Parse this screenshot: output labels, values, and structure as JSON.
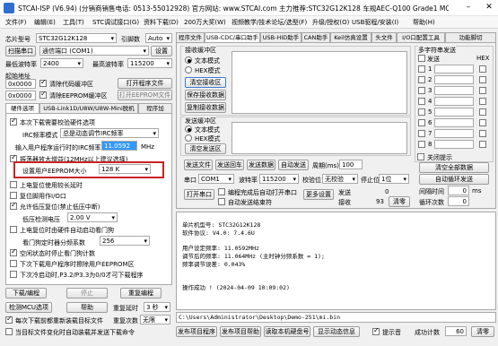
{
  "window": {
    "title": "STCAI-ISP (V6.94) (分销商销售电话: 0513-55012928) 官方网站: www.STCAI.com  主力推荐:STC32G12K128  车规AEC-Q100 Grade1 MCU设计公司 使用本芯片或采用"
  },
  "menu": [
    "文件(F)",
    "编辑(E)",
    "工具(T)",
    "STC调试接口(G)",
    "资料下载(D)",
    "200万大奖(W)",
    "视频教学/技术论坛/选型(F)",
    "升级/授权(O)",
    "USB驱程/安装(I)",
    "帮助(H)"
  ],
  "left": {
    "chip_model_label": "芯片型号",
    "chip_model": "STC32G12K128",
    "pin_count_label": "引脚数",
    "pin_count": "Auto",
    "scan_port_button": "扫描串口",
    "port_value": "通信端口 (COM1)",
    "settings_button": "设置",
    "min_baud_label": "最低波特率",
    "min_baud": "2400",
    "max_baud_label": "最高波特率",
    "max_baud": "115200",
    "start_addr_label": "起始地址",
    "addr1": "0x0000",
    "clear_code_buffer": "清除代码缓冲区",
    "open_program_file": "打开程序文件",
    "addr2": "0x0000",
    "clear_eeprom_buffer": "清除EEPROM缓冲区",
    "open_eeprom_file": "打开EEPROM文件",
    "tabs": [
      "硬件选项",
      "USB-Link1D/U8W/U8W-Mini脱机",
      "程序加"
    ],
    "options": {
      "o1": "本次下载需要校验硬件选项",
      "irc_mode_label": "IRC频率模式",
      "irc_mode": "总是动态调节IRC频率",
      "input_freq_label": "输入用户程序运行时的IRC频率",
      "input_freq": "11.0592",
      "freq_unit": "MHz",
      "o2": "振荡器放大增益(12MHz以上建议选择)",
      "eeprom_size_label": "设置用户EEPROM大小",
      "eeprom_size": "128  K",
      "o3": "上电复位使用较长延时",
      "o4": "复位脚用作I/O口",
      "o5": "允许低压复位(禁止低压中断)",
      "lvd_label": "低压检测电压",
      "lvd_value": "2.00 V",
      "o6": "上电复位时由硬件自动启动看门狗",
      "wdt_label": "看门狗定时器分频系数",
      "wdt_value": "256",
      "o7": "空闲状态时停止看门狗计数",
      "o8": "下次下载用户程序时擦除用户EEPROM区",
      "o9": "下次冷启动时,P3.2/P3.3为0/0才可下载程序"
    },
    "download_button": "下载/编程",
    "stop_button": "停止",
    "reprogram_button": "重复编程",
    "detect_mcu_button": "检测MCU选项",
    "help_button": "帮助",
    "delay_label": "重复延时",
    "delay_value": "3 秒",
    "o10": "每次下载前都重新装载目标文件",
    "repeat_count_label": "重复次数",
    "repeat_count": "无限",
    "o11": "当目标文件变化时自动装载并发送下载命令"
  },
  "right": {
    "tabs": [
      "程序文件",
      "USB-CDC/串口助手",
      "USB-HID助手",
      "CAN助手",
      "Keil仿真设置",
      "头文件",
      "I/O口配置工具",
      "功能脚切"
    ],
    "rx_group": "接收缓冲区",
    "text_mode": "文本模式",
    "hex_mode": "HEX模式",
    "clear_rx": "清空接收区",
    "save_rx": "保存接收数据",
    "copy_rx": "复制接收数据",
    "tx_group": "发送缓冲区",
    "clear_tx": "清空发送区",
    "send_file": "发送文件",
    "send_enter": "发送回车",
    "send_data": "发送数据",
    "auto_send": "自动发送",
    "period_label": "周期(ms)",
    "period": "100",
    "port_label": "串口",
    "port": "COM1",
    "baud_label": "波特率",
    "baud": "115200",
    "parity_label": "校验位",
    "parity": "无校验",
    "stopbits_label": "停止位",
    "stopbits": "1位",
    "open_port": "打开串口",
    "auto_open": "编程完成后自动打开串口",
    "auto_close": "自动发送结束符",
    "more_settings": "更多设置",
    "tx_label": "发送",
    "tx_count": "0",
    "rx_label": "接收",
    "rx_count": "93",
    "clear_counts": "清零",
    "multi_group": "多字符串发送",
    "col_send": "发送",
    "col_hex": "HEX",
    "multi_rows": [
      "1",
      "2",
      "3",
      "4",
      "5",
      "6",
      "7",
      "8"
    ],
    "close_hint": "关闭提示",
    "clear_all": "清空全部数据",
    "auto_loop": "自动循环发送",
    "interval_label": "间隔时间",
    "interval_value": "0",
    "interval_unit": "ms",
    "loop_label": "循环次数",
    "loop_value": "0"
  },
  "log": {
    "lines": [
      "单片机型号: STC32G12K128",
      "软件协议: V4.0: 7.4.6U",
      "",
      "用户设定频率: 11.0592MHz",
      "调节后的频率: 11.064MHz (主时钟分频系数 = 1);",
      "频率调节误差: 0.043%",
      "",
      "",
      "操作成功 ! (2024-04-09 10:09:02)"
    ],
    "path": "C:\\Users\\Administrator\\Desktop\\Demo-251\\mi.bin"
  },
  "bottom": {
    "publish_project": "发布项目程序",
    "publish_help": "发布项目帮助",
    "read_disk": "读取本机硬盘号",
    "show_dynamic": "显示动态信息",
    "hint_label": "提示音",
    "success_label": "成功计数",
    "success_count": "60",
    "clear": "清零"
  },
  "colors": {
    "highlight": "#cc2222",
    "selection": "#3399ff"
  }
}
